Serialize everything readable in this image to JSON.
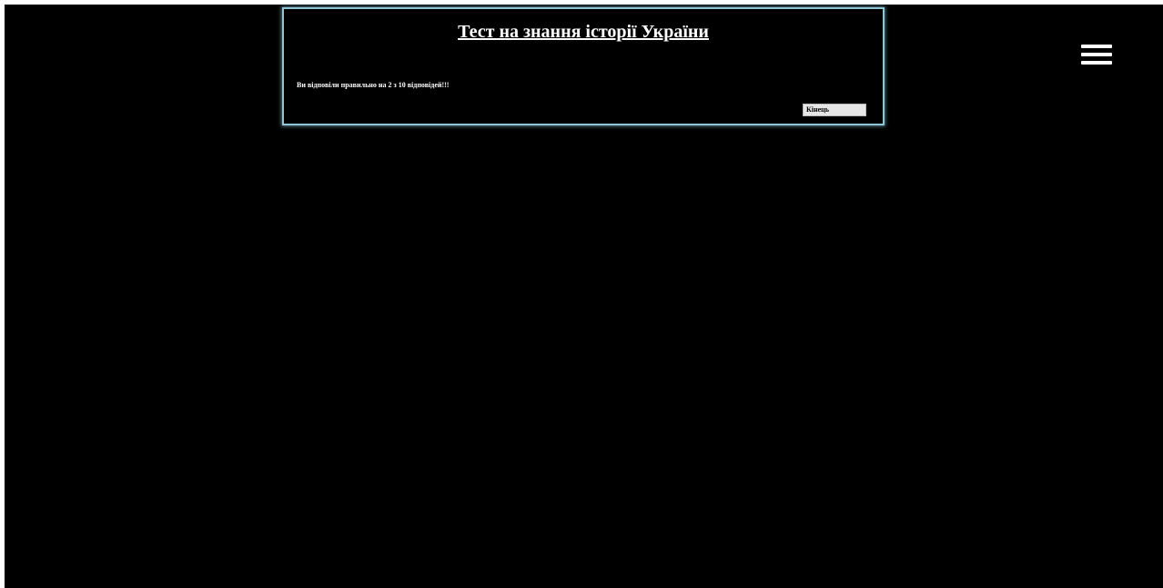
{
  "quiz": {
    "title": "Тест на знання історії України",
    "result": "Ви відповіли правильно на 2 з 10 відповідей!!!",
    "finish_label": "Кінець"
  },
  "menu": {
    "icon": "hamburger-menu-icon"
  },
  "colors": {
    "background": "#000000",
    "panel_border": "#8fc6d6",
    "text": "#ffffff",
    "button_bg": "#e6e6e6"
  }
}
